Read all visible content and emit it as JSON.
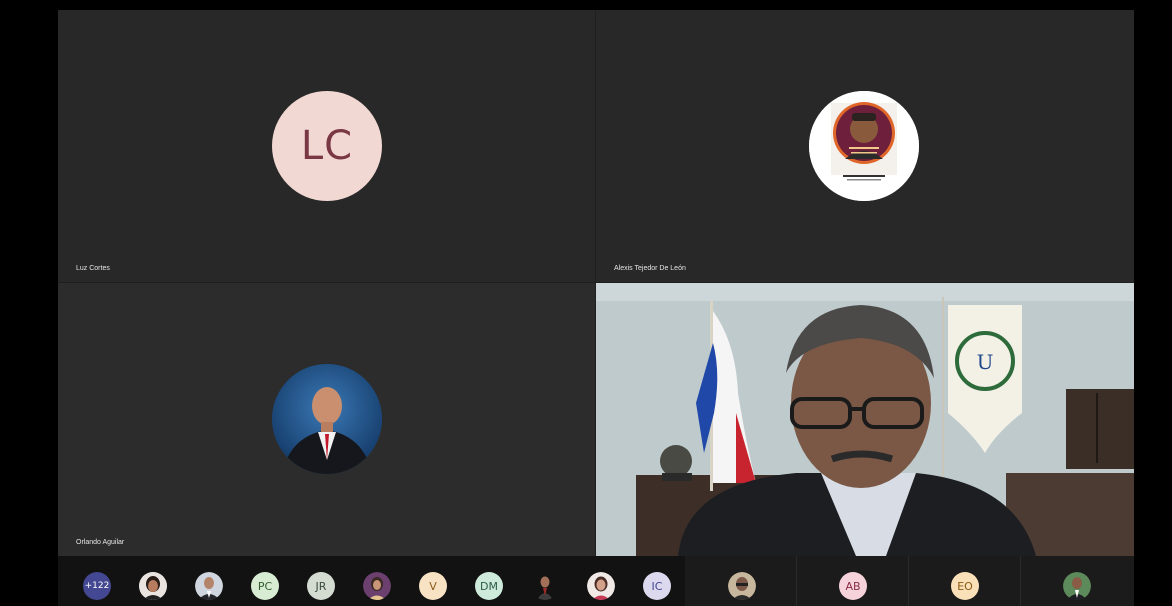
{
  "tiles": [
    {
      "name": "Luz Cortes",
      "initials": "LC"
    },
    {
      "name": "Alexis Tejedor De León"
    },
    {
      "name": "Orlando Aguilar"
    },
    {
      "name": ""
    }
  ],
  "strip": {
    "overflow_count": "+122",
    "initials": [
      "PC",
      "JR",
      "V",
      "DM",
      "IC",
      "AB",
      "EO"
    ]
  },
  "colors": {
    "background": "#000000",
    "tile": "#282828",
    "lc_avatar_bg": "#f1d8d2",
    "lc_avatar_text": "#7a3845"
  }
}
